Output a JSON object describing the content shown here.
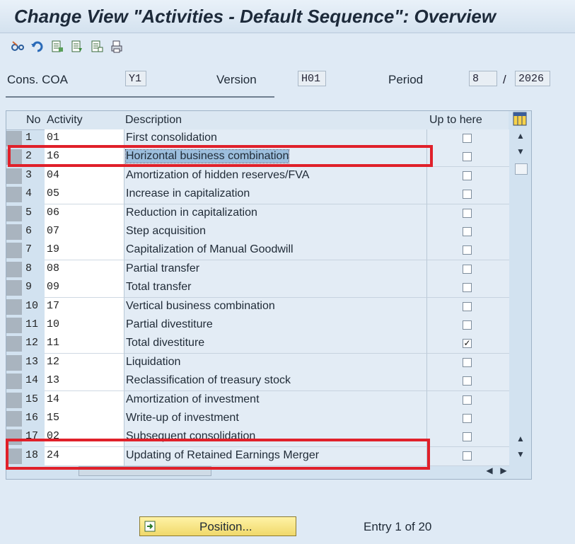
{
  "window": {
    "title": "Change View \"Activities - Default Sequence\": Overview"
  },
  "toolbar": {
    "buttons": [
      {
        "icon": "glasses-change-icon"
      },
      {
        "icon": "undo-icon"
      },
      {
        "icon": "copy-icon"
      },
      {
        "icon": "new-entries-icon"
      },
      {
        "icon": "select-all-icon"
      },
      {
        "icon": "print-icon"
      }
    ]
  },
  "header": {
    "cons_coa_label": "Cons. COA",
    "cons_coa_value": "Y1",
    "version_label": "Version",
    "version_value": "H01",
    "period_label": "Period",
    "period_value": "8",
    "period_sep": "/",
    "year_value": "2026"
  },
  "table": {
    "columns": {
      "no": "No",
      "activity": "Activity",
      "description": "Description",
      "up_to_here": "Up to here"
    },
    "rows": [
      {
        "no": "1",
        "activity": "01",
        "description": "First consolidation",
        "up_to_here": false
      },
      {
        "no": "2",
        "activity": "16",
        "description": "Horizontal business combination",
        "up_to_here": false,
        "highlight": true
      },
      {
        "no": "3",
        "activity": "04",
        "description": "Amortization of hidden reserves/FVA",
        "up_to_here": false
      },
      {
        "no": "4",
        "activity": "05",
        "description": "Increase in capitalization",
        "up_to_here": false
      },
      {
        "no": "5",
        "activity": "06",
        "description": "Reduction in capitalization",
        "up_to_here": false
      },
      {
        "no": "6",
        "activity": "07",
        "description": "Step acquisition",
        "up_to_here": false
      },
      {
        "no": "7",
        "activity": "19",
        "description": "Capitalization of Manual Goodwill",
        "up_to_here": false
      },
      {
        "no": "8",
        "activity": "08",
        "description": "Partial transfer",
        "up_to_here": false
      },
      {
        "no": "9",
        "activity": "09",
        "description": "Total transfer",
        "up_to_here": false
      },
      {
        "no": "10",
        "activity": "17",
        "description": "Vertical business combination",
        "up_to_here": false
      },
      {
        "no": "11",
        "activity": "10",
        "description": "Partial divestiture",
        "up_to_here": false
      },
      {
        "no": "12",
        "activity": "11",
        "description": "Total divestiture",
        "up_to_here": true
      },
      {
        "no": "13",
        "activity": "12",
        "description": "Liquidation",
        "up_to_here": false
      },
      {
        "no": "14",
        "activity": "13",
        "description": "Reclassification of treasury stock",
        "up_to_here": false
      },
      {
        "no": "15",
        "activity": "14",
        "description": "Amortization of investment",
        "up_to_here": false
      },
      {
        "no": "16",
        "activity": "15",
        "description": "Write-up of investment",
        "up_to_here": false
      },
      {
        "no": "17",
        "activity": "02",
        "description": "Subsequent consolidation",
        "up_to_here": false
      },
      {
        "no": "18",
        "activity": "24",
        "description": "Updating of Retained Earnings Merger",
        "up_to_here": false
      }
    ]
  },
  "footer": {
    "position_button": "Position...",
    "entry_info": "Entry 1 of 20"
  },
  "colors": {
    "highlight_box": "#e0202a",
    "position_button": "#f0d86a"
  }
}
